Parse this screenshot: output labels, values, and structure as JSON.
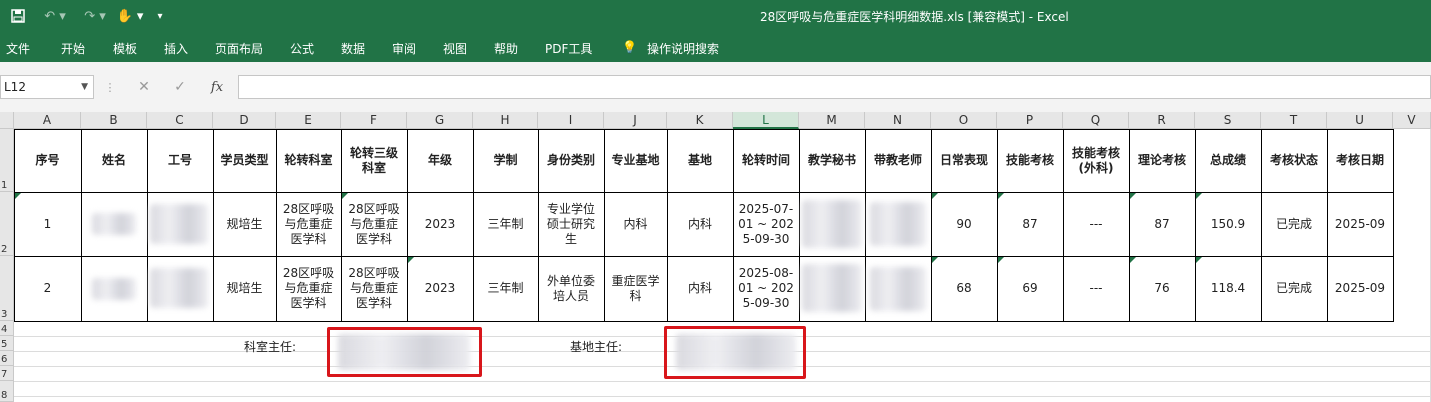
{
  "window": {
    "title": "28区呼吸与危重症医学科明细数据.xls  [兼容模式]  -  Excel"
  },
  "menu": [
    "文件",
    "开始",
    "模板",
    "插入",
    "页面布局",
    "公式",
    "数据",
    "审阅",
    "视图",
    "帮助",
    "PDF工具",
    "操作说明搜索"
  ],
  "formula_bar": {
    "name_box": "L12",
    "fx": "fx",
    "value": ""
  },
  "columns": [
    "A",
    "B",
    "C",
    "D",
    "E",
    "F",
    "G",
    "H",
    "I",
    "J",
    "K",
    "L",
    "M",
    "N",
    "O",
    "P",
    "Q",
    "R",
    "S",
    "T",
    "U",
    "V"
  ],
  "selected_column": "L",
  "rows": [
    "1",
    "2",
    "3",
    "4",
    "5",
    "6",
    "7",
    "8"
  ],
  "table": {
    "headers": [
      "序号",
      "姓名",
      "工号",
      "学员类型",
      "轮转科室",
      "轮转三级科室",
      "年级",
      "学制",
      "身份类别",
      "专业基地",
      "基地",
      "轮转时间",
      "教学秘书",
      "带教老师",
      "日常表现",
      "技能考核",
      "技能考核(外科)",
      "理论考核",
      "总成绩",
      "考核状态",
      "考核日期"
    ],
    "records": [
      [
        "1",
        "",
        "",
        "规培生",
        "28区呼吸与危重症医学科",
        "28区呼吸与危重症医学科",
        "2023",
        "三年制",
        "专业学位硕士研究生",
        "内科",
        "内科",
        "2025-07-01 ~ 2025-09-30",
        "",
        "",
        "90",
        "87",
        "---",
        "87",
        "150.9",
        "已完成",
        "2025-09"
      ],
      [
        "2",
        "",
        "",
        "规培生",
        "28区呼吸与危重症医学科",
        "28区呼吸与危重症医学科",
        "2023",
        "三年制",
        "外单位委培人员",
        "重症医学科",
        "内科",
        "2025-08-01 ~ 2025-09-30",
        "",
        "",
        "68",
        "69",
        "---",
        "76",
        "118.4",
        "已完成",
        "2025-09"
      ]
    ]
  },
  "signatures": {
    "dept_head_label": "科室主任:",
    "base_head_label": "基地主任:"
  },
  "colors": {
    "ribbon": "#217346",
    "highlight_border": "#d8161b"
  }
}
